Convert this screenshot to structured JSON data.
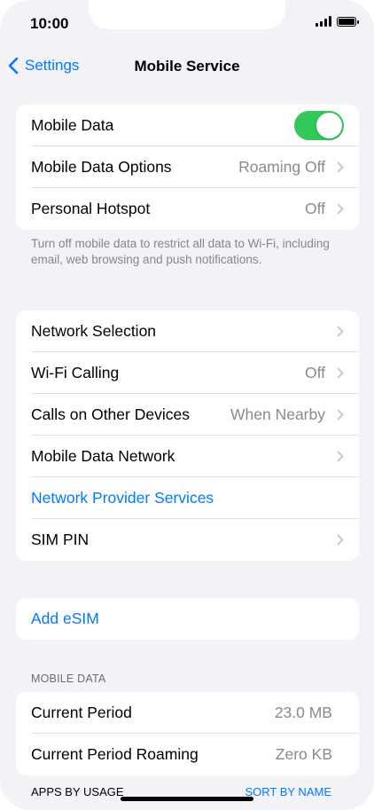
{
  "status": {
    "time": "10:00"
  },
  "nav": {
    "back_label": "Settings",
    "title": "Mobile Service"
  },
  "group1": {
    "mobile_data": {
      "label": "Mobile Data",
      "toggle_on": true
    },
    "options": {
      "label": "Mobile Data Options",
      "value": "Roaming Off"
    },
    "hotspot": {
      "label": "Personal Hotspot",
      "value": "Off"
    }
  },
  "note": "Turn off mobile data to restrict all data to Wi-Fi, including email, web browsing and push notifications.",
  "group2": {
    "network_selection": {
      "label": "Network Selection"
    },
    "wifi_calling": {
      "label": "Wi-Fi Calling",
      "value": "Off"
    },
    "other_devices": {
      "label": "Calls on Other Devices",
      "value": "When Nearby"
    },
    "data_network": {
      "label": "Mobile Data Network"
    },
    "provider_services": {
      "label": "Network Provider Services"
    },
    "sim_pin": {
      "label": "SIM PIN"
    }
  },
  "group3": {
    "add_esim": {
      "label": "Add eSIM"
    }
  },
  "mobile_data_section": {
    "header": "MOBILE DATA",
    "current_period": {
      "label": "Current Period",
      "value": "23.0 MB"
    },
    "current_roaming": {
      "label": "Current Period Roaming",
      "value": "Zero KB"
    }
  },
  "apps": {
    "header": "APPS BY USAGE",
    "sort_label": "SORT BY NAME"
  },
  "colors": {
    "accent": "#007aff",
    "toggle_on": "#34c759",
    "background": "#f2f2f7"
  }
}
